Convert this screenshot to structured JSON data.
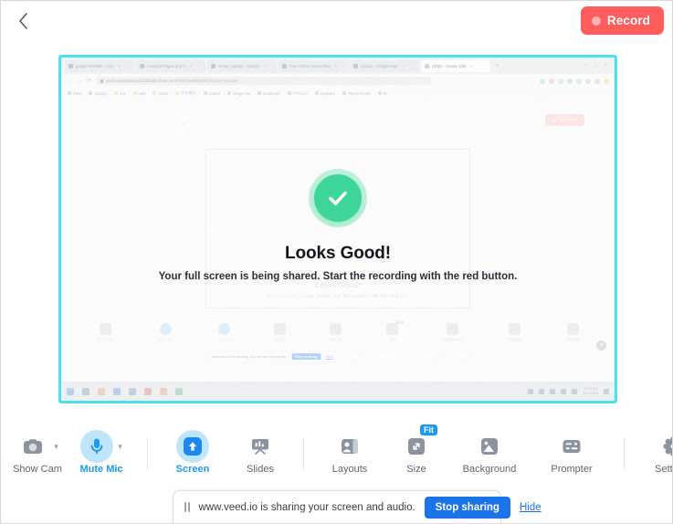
{
  "topbar": {
    "back_icon": "chevron-left-icon",
    "record": {
      "label": "Record",
      "color": "#FF5C5C",
      "dot_icon": "record-dot-icon"
    }
  },
  "preview": {
    "border_color": "#4DE0F0",
    "status": {
      "check_icon": "check-circle-icon",
      "check_color": "#3ED598",
      "title": "Looks Good!",
      "subtitle": "Your full screen is being shared. Start the recording with the red button."
    },
    "ghost": {
      "tabs": [
        {
          "title": "google translate - Goo"
        },
        {
          "title": "Analytics Pages and S"
        },
        {
          "title": "screen capture - Google"
        },
        {
          "title": "Free Online Screen Rec"
        },
        {
          "title": "veed.io - Google Sear"
        },
        {
          "title": "VEED - Create, Edit"
        }
      ],
      "new_tab_label": "+",
      "url": "veed.io/workspaces/18d5dabb-35a3-4a76-91b3-6e90514917/screen-recorder",
      "bookmarks": [
        "FWK",
        "Google",
        "311",
        "post",
        "Tasks",
        "中文输入",
        "extinct",
        "image site",
        "bookmark",
        "TTTCCA",
        "myshare",
        "Panel Center",
        "W"
      ],
      "inner_title": "Looks Good!",
      "inner_subtitle": "Your full screen is being shared. Start the recording with the red button.",
      "inner_record_label": "Record",
      "inner_tools": [
        {
          "label": "Show Cam",
          "active": false
        },
        {
          "label": "Mute Mic",
          "active": true
        },
        {
          "label": "Screen",
          "active": true
        },
        {
          "label": "Slides",
          "active": false
        },
        {
          "label": "Layouts",
          "active": false
        },
        {
          "label": "Size",
          "active": false,
          "badge": "Fit"
        },
        {
          "label": "Background",
          "active": false
        },
        {
          "label": "Prompter",
          "active": false
        },
        {
          "label": "Settings",
          "active": false
        }
      ],
      "inner_sharebar": {
        "text": "www.veed.io is sharing your screen and audio.",
        "stop": "Stop sharing",
        "hide": "Hide"
      },
      "taskbar": {
        "time": "10:11 AM",
        "date": "11/7/2023"
      },
      "close_label": "×"
    }
  },
  "toolbar": {
    "items": [
      {
        "label": "Show Cam",
        "icon": "camera-icon",
        "active": false,
        "caret": true,
        "badge": null
      },
      {
        "label": "Mute Mic",
        "icon": "microphone-icon",
        "active": true,
        "caret": true,
        "badge": null
      },
      {
        "label": "Screen",
        "icon": "screen-share-icon",
        "active": true,
        "caret": false,
        "badge": null
      },
      {
        "label": "Slides",
        "icon": "slides-icon",
        "active": false,
        "caret": false,
        "badge": null
      },
      {
        "label": "Layouts",
        "icon": "layouts-icon",
        "active": false,
        "caret": false,
        "badge": null
      },
      {
        "label": "Size",
        "icon": "resize-icon",
        "active": false,
        "caret": false,
        "badge": "Fit"
      },
      {
        "label": "Background",
        "icon": "background-icon",
        "active": false,
        "caret": false,
        "badge": null
      },
      {
        "label": "Prompter",
        "icon": "prompter-icon",
        "active": false,
        "caret": false,
        "badge": null
      },
      {
        "label": "Settings",
        "icon": "gear-icon",
        "active": false,
        "caret": false,
        "badge": null
      }
    ],
    "accent": "#1a9bf0"
  },
  "sharebar": {
    "pause_icon": "pause-icon",
    "text": "www.veed.io is sharing your screen and audio.",
    "stop_label": "Stop sharing",
    "hide_label": "Hide",
    "accent": "#1a73e8"
  }
}
